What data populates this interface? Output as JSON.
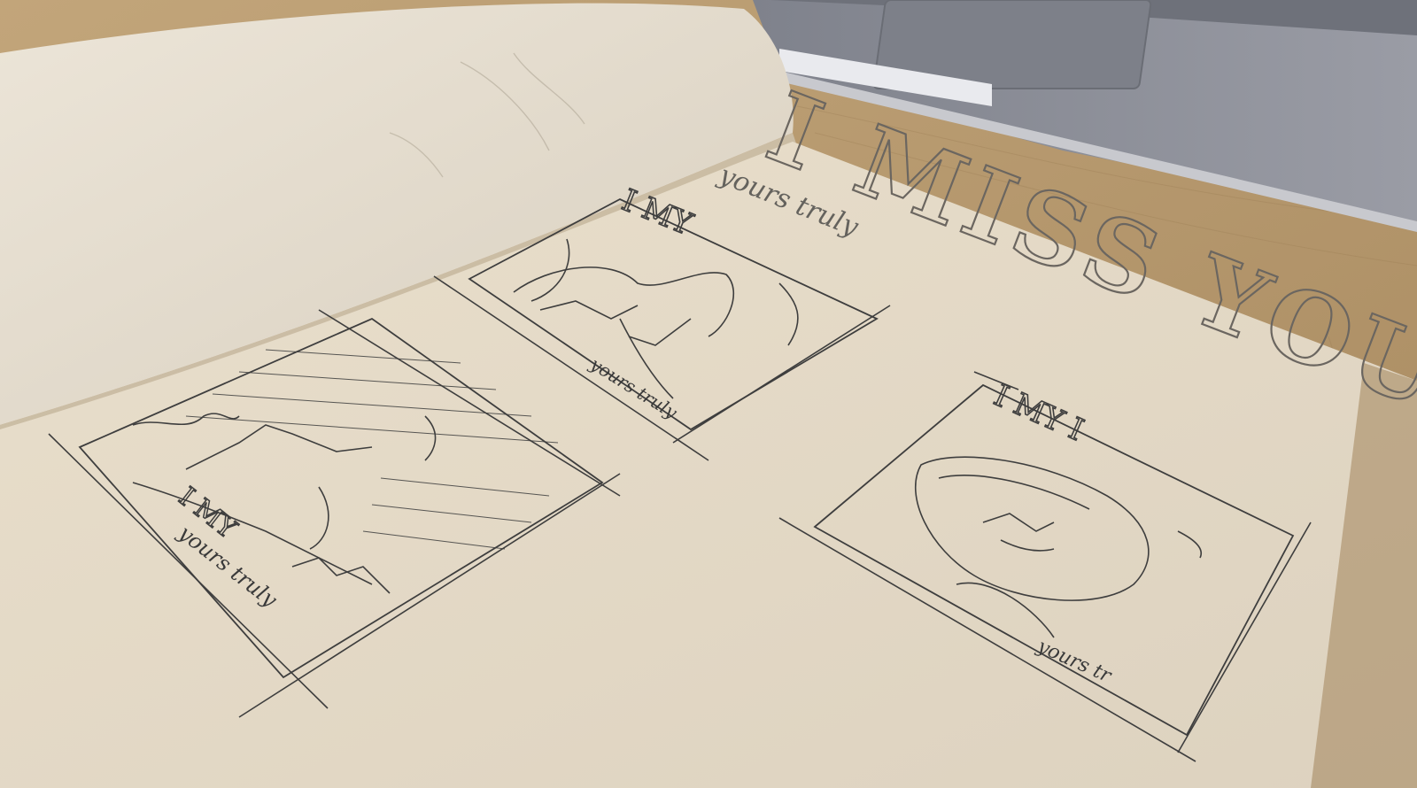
{
  "photo": {
    "subject": "Open sketchbook with pencil thumbnail sketches on a wooden desk beside a laptop",
    "colors": {
      "desk": "#b6966a",
      "desk_dark": "#9f7f55",
      "paper": "#e8dfcf",
      "paper_shadow": "#d9cfbd",
      "laptop": "#8d8f98",
      "laptop_dark": "#5f626b",
      "pencil": "#3a3a3a"
    }
  },
  "sketchbook": {
    "title_lettering": "I MISS YOU",
    "subtitle_script": "yours truly",
    "thumbnails": [
      {
        "heading": "I MY",
        "caption": "yours truly"
      },
      {
        "heading": "I MY",
        "caption": "yours truly"
      },
      {
        "heading": "I MY I",
        "caption": "yours tr"
      }
    ]
  }
}
